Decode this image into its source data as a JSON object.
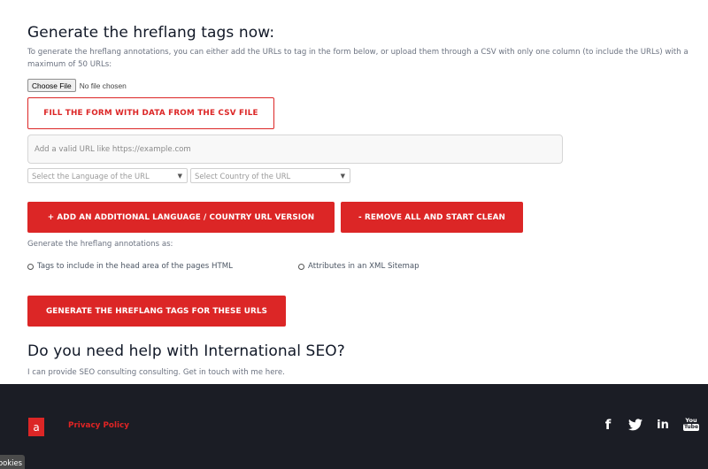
{
  "form": {
    "heading": "Generate the hreflang tags now:",
    "intro": "To generate the hreflang annotations, you can either add the URLs to tag in the form below, or upload them through a CSV with only one column (to include the URLs) with a maximum of 50 URLs:",
    "file_button_label": "Choose File",
    "file_status": "No file chosen",
    "fill_csv_button": "FILL THE FORM WITH DATA FROM THE CSV FILE",
    "url_placeholder": "Add a valid URL like https://example.com",
    "language_select": "Select the Language of the URL",
    "country_select": "Select Country of the URL",
    "add_button": "+ ADD AN ADDITIONAL LANGUAGE / COUNTRY URL VERSION",
    "remove_button": "- REMOVE ALL AND START CLEAN",
    "generate_as_label": "Generate the hreflang annotations as:",
    "option_head": "Tags to include in the head area of the pages HTML",
    "option_xml": "Attributes in an XML Sitemap",
    "generate_button": "GENERATE THE HREFLANG TAGS FOR THESE URLS"
  },
  "help": {
    "heading": "Do you need help with International SEO?",
    "text": "I can provide SEO consulting consulting. Get in touch with me here."
  },
  "footer": {
    "logo_letter": "a",
    "privacy_link": "Privacy Policy",
    "social": {
      "facebook": "f",
      "linkedin": "in",
      "youtube_top": "You",
      "youtube_box": "Tube"
    }
  },
  "cookies_tab": "Cookies",
  "colors": {
    "accent": "#dc2626",
    "footer_bg": "#1b1d25"
  },
  "icons": [
    "facebook-icon",
    "twitter-icon",
    "linkedin-icon",
    "youtube-icon",
    "chevron-down-icon"
  ]
}
